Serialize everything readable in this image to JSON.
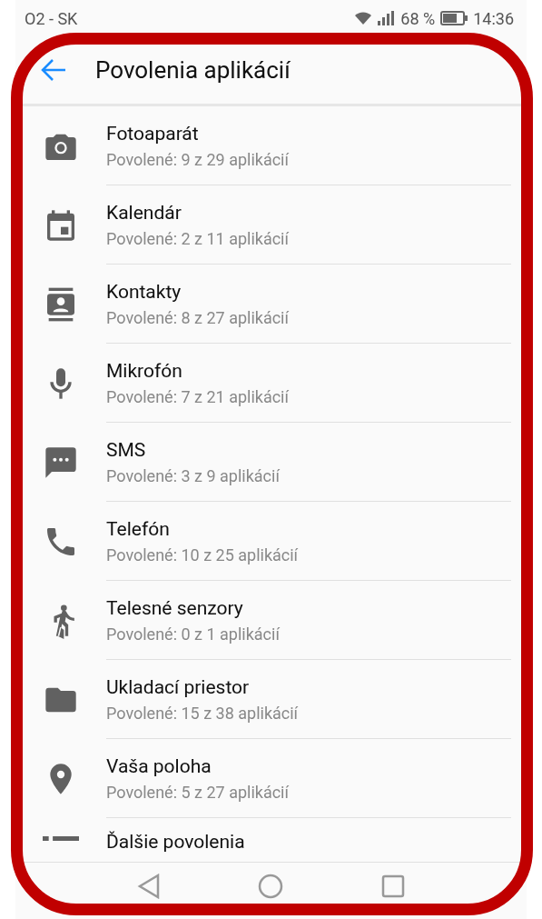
{
  "status_bar": {
    "carrier": "O2 - SK",
    "battery": "68 %",
    "time": "14:36"
  },
  "header": {
    "title": "Povolenia aplikácií"
  },
  "permissions": [
    {
      "name": "Fotoaparát",
      "summary": "Povolené: 9 z 29 aplikácií"
    },
    {
      "name": "Kalendár",
      "summary": "Povolené: 2 z 11 aplikácií"
    },
    {
      "name": "Kontakty",
      "summary": "Povolené: 8 z 27 aplikácií"
    },
    {
      "name": "Mikrofón",
      "summary": "Povolené: 7 z 21 aplikácií"
    },
    {
      "name": "SMS",
      "summary": "Povolené: 3 z 9 aplikácií"
    },
    {
      "name": "Telefón",
      "summary": "Povolené: 10 z 25 aplikácií"
    },
    {
      "name": "Telesné senzory",
      "summary": "Povolené: 0 z 1 aplikácií"
    },
    {
      "name": "Ukladací priestor",
      "summary": "Povolené: 15 z 38 aplikácií"
    },
    {
      "name": "Vaša poloha",
      "summary": "Povolené: 5 z 27 aplikácií"
    },
    {
      "name": "Ďalšie povolenia"
    }
  ]
}
